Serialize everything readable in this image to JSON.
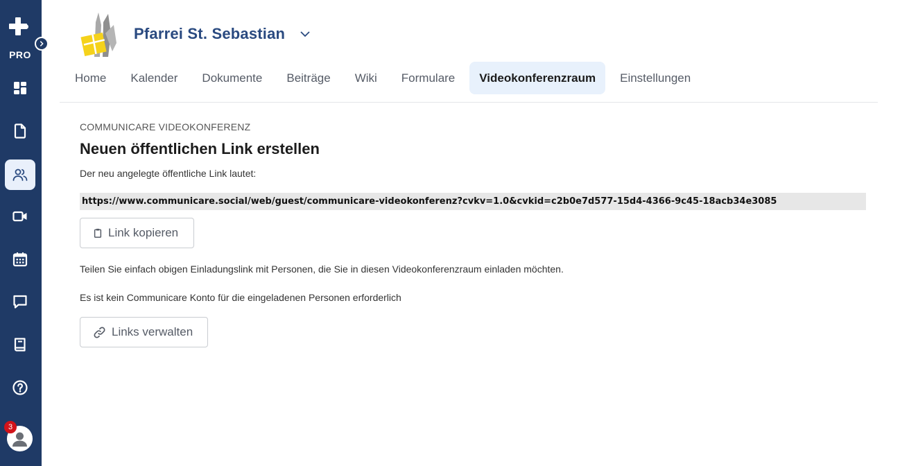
{
  "sidebar": {
    "brand_label": "PRO",
    "items": [
      {
        "icon": "dashboard-icon"
      },
      {
        "icon": "document-icon"
      },
      {
        "icon": "users-icon"
      },
      {
        "icon": "video-icon"
      },
      {
        "icon": "calendar-icon"
      },
      {
        "icon": "chat-icon"
      },
      {
        "icon": "book-icon"
      },
      {
        "icon": "help-icon"
      }
    ],
    "notification_count": "3"
  },
  "header": {
    "org_name": "Pfarrei St. Sebastian"
  },
  "tabs": [
    {
      "label": "Home"
    },
    {
      "label": "Kalender"
    },
    {
      "label": "Dokumente"
    },
    {
      "label": "Beiträge"
    },
    {
      "label": "Wiki"
    },
    {
      "label": "Formulare"
    },
    {
      "label": "Videokonferenzraum",
      "active": true
    },
    {
      "label": "Einstellungen"
    }
  ],
  "main": {
    "eyebrow": "COMMUNICARE VIDEOKONFERENZ",
    "heading": "Neuen öffentlichen Link erstellen",
    "intro": "Der neu angelegte öffentliche Link lautet:",
    "link": "https://www.communicare.social/web/guest/communicare-videokonferenz?cvkv=1.0&cvkid=c2b0e7d577-15d4-4366-9c45-18acb34e3085",
    "copy_button": "Link kopieren",
    "share_text": "Teilen Sie einfach obigen Einladungslink mit Personen, die Sie in diesen Videokonferenzraum einladen möchten.",
    "no_account_text": "Es ist kein Communicare Konto für die eingeladenen Personen erforderlich",
    "manage_button": "Links verwalten"
  },
  "colors": {
    "sidebar_bg": "#1f3a66",
    "title_blue": "#2a4a80",
    "active_tab_bg": "#e8f1fc",
    "badge_red": "#d1131a",
    "logo_yellow": "#f5d21b"
  }
}
